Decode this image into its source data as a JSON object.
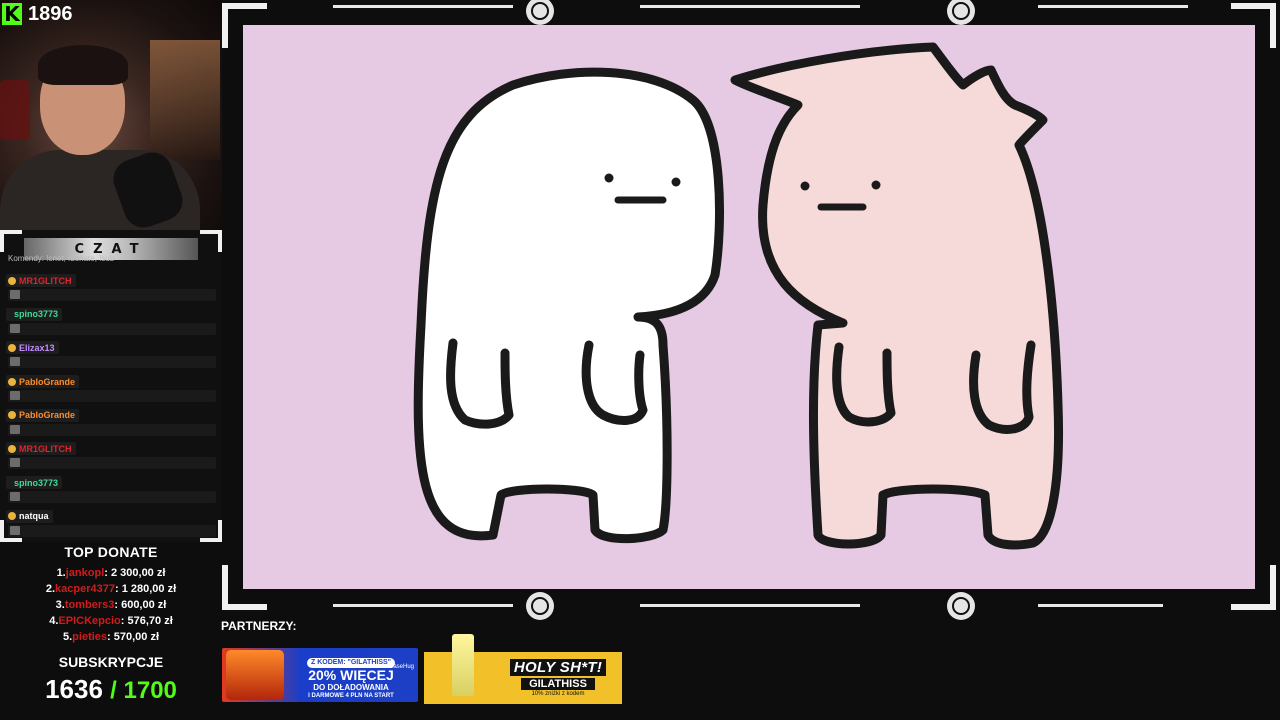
{
  "viewers": {
    "count": "1896",
    "platform_logo": "K"
  },
  "chat": {
    "header": "CZAT",
    "commands": "Komendy: !cnet, !donate, !sub",
    "messages": [
      {
        "user": "MR1GLITCH",
        "color": "#e0232d",
        "badge": true
      },
      {
        "user": "spino3773",
        "color": "#3ddc97",
        "badge": false
      },
      {
        "user": "Elizax13",
        "color": "#c38cff",
        "badge": true
      },
      {
        "user": "PabloGrande",
        "color": "#ff8c2a",
        "badge": true
      },
      {
        "user": "PabloGrande",
        "color": "#ff8c2a",
        "badge": true
      },
      {
        "user": "MR1GLITCH",
        "color": "#e0232d",
        "badge": true
      },
      {
        "user": "spino3773",
        "color": "#3ddc97",
        "badge": false
      },
      {
        "user": "natqua",
        "color": "#ffffff",
        "badge": true
      }
    ]
  },
  "top_donate": {
    "title": "TOP DONATE",
    "entries": [
      {
        "rank": "1.",
        "name": "jankopl",
        "amount": ": 2 300,00 zł"
      },
      {
        "rank": "2.",
        "name": "kacper4377",
        "amount": ": 1 280,00 zł"
      },
      {
        "rank": "3.",
        "name": "tombers3",
        "amount": ": 600,00 zł"
      },
      {
        "rank": "4.",
        "name": "EPICKepcio",
        "amount": ": 576,70 zł"
      },
      {
        "rank": "5.",
        "name": "pieties",
        "amount": ": 570,00 zł"
      }
    ]
  },
  "subs": {
    "title": "SUBSKRYPCJE",
    "current": "1636",
    "goal": "/ 1700"
  },
  "partners": {
    "label": "PARTNERZY:",
    "ad1": {
      "promo": "Z KODEM: \"GILATHISS\"",
      "big": "20% WIĘCEJ",
      "mid": "DO DOŁADOWANIA",
      "small": "I DARMOWE 4 PLN NA START",
      "brand": "CaseHug"
    },
    "ad2": {
      "title": "HOLY SH*T!",
      "code": "GILATHISS",
      "note": "10% zniżki z kodem"
    }
  },
  "icons": [
    "kick-logo-icon",
    "chat-avatar-icon",
    "emblem-icon"
  ]
}
